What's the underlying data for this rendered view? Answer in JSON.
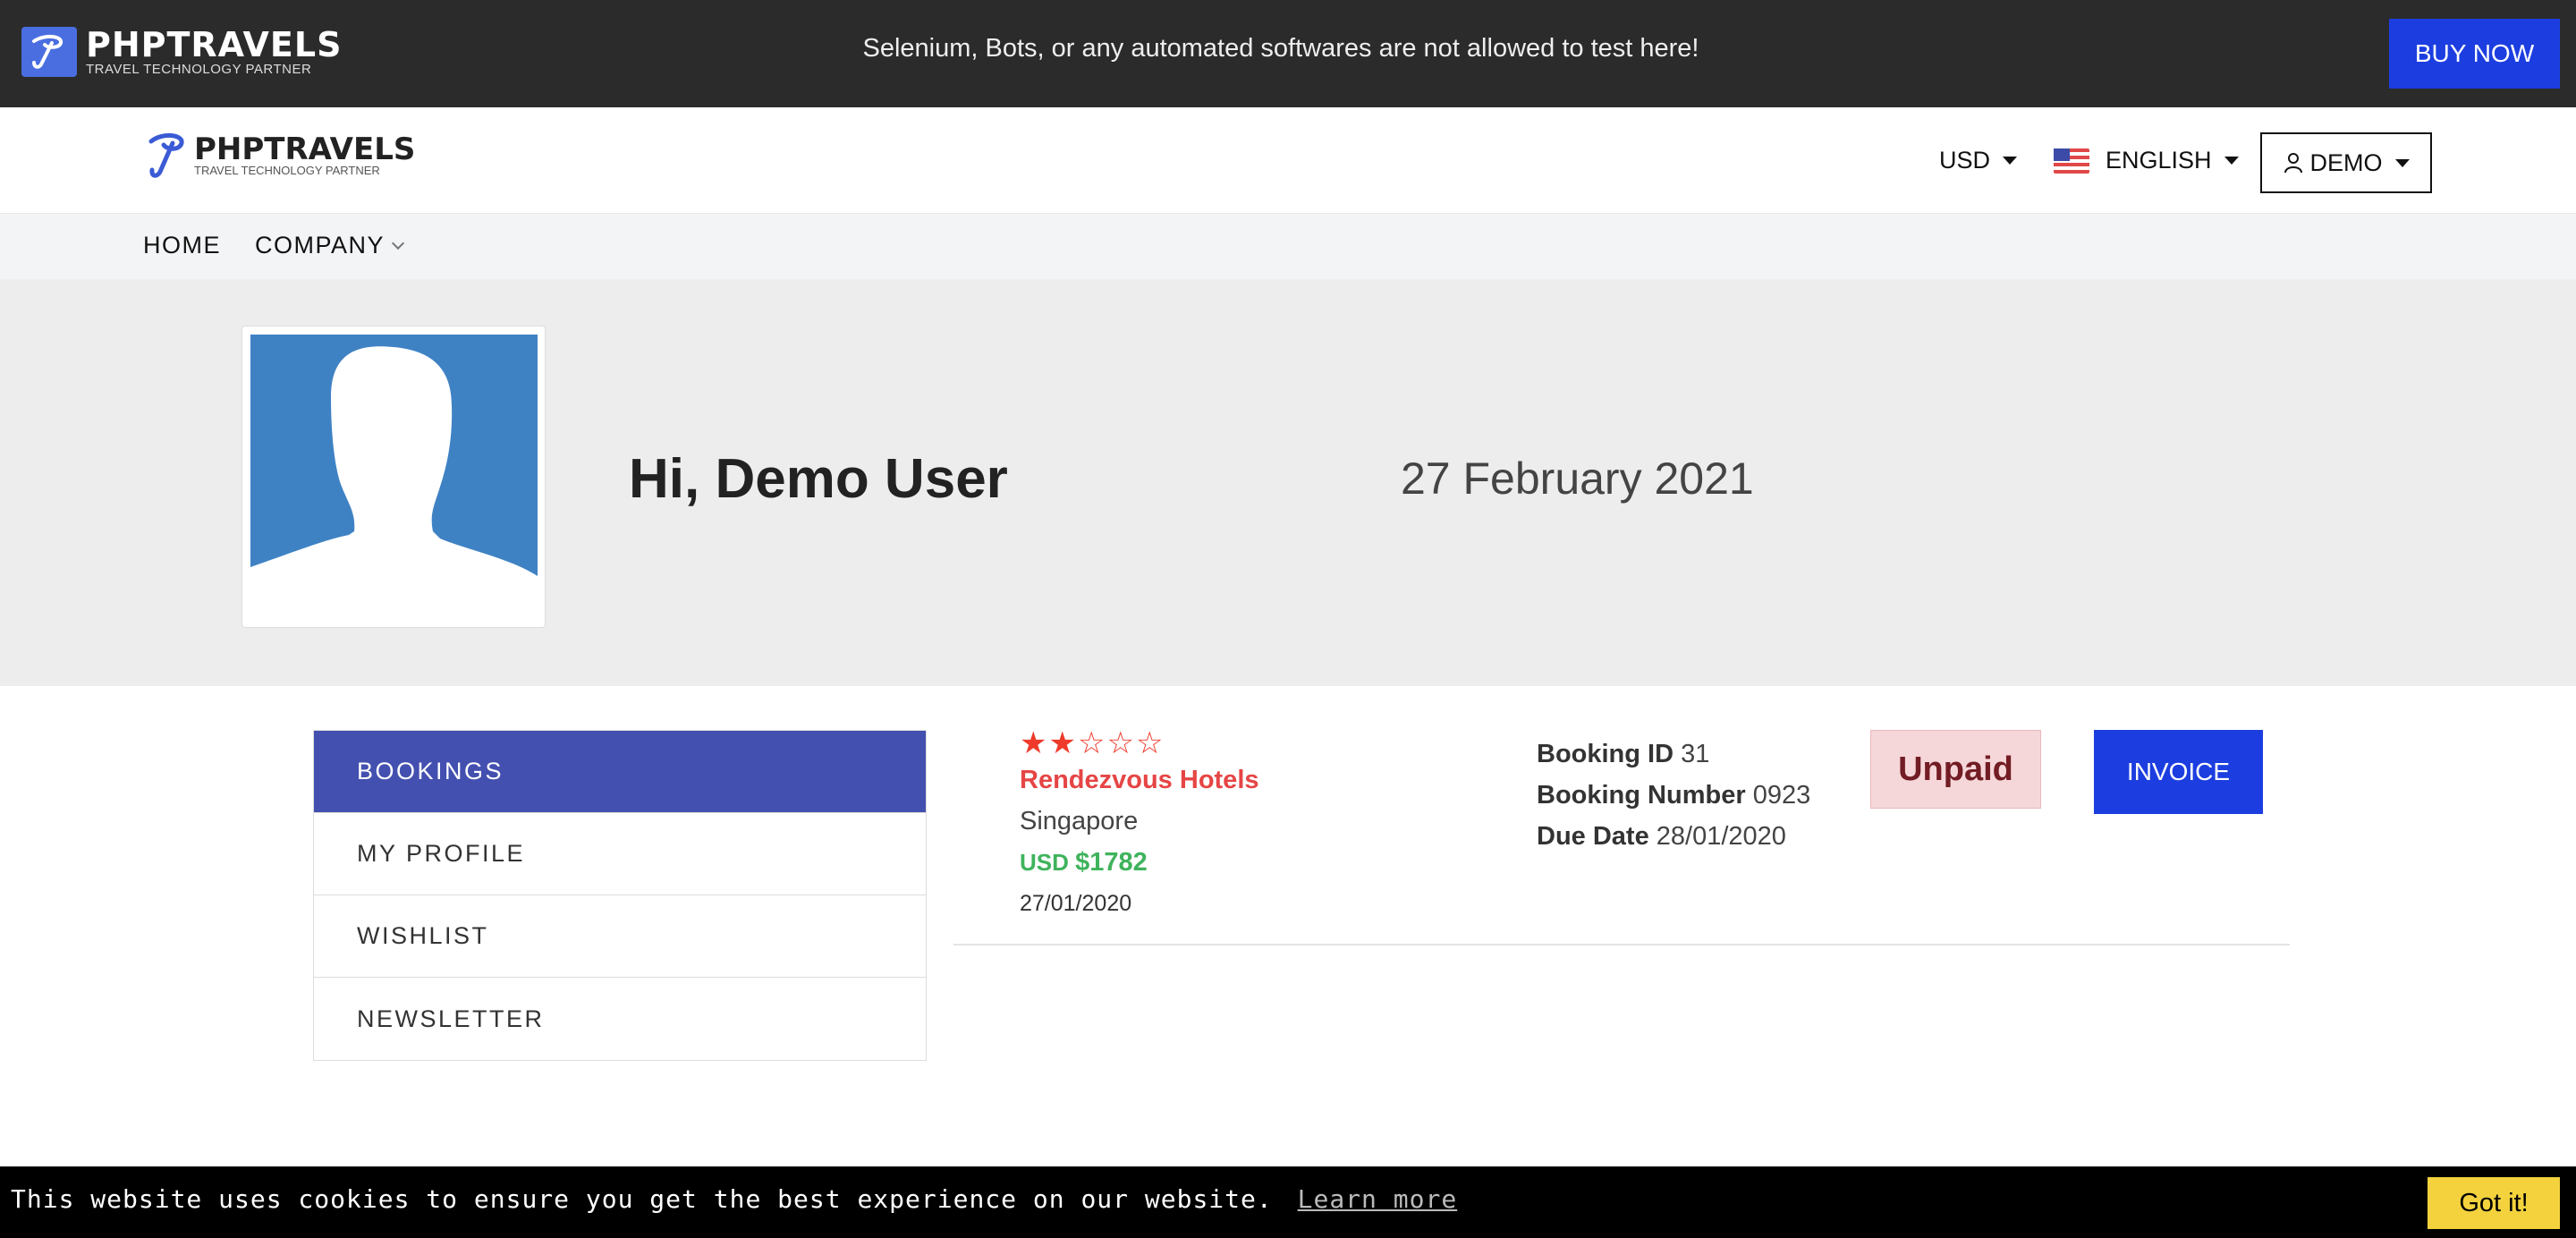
{
  "topbar": {
    "brand": "PHPTRAVELS",
    "tagline": "TRAVEL TECHNOLOGY PARTNER",
    "notice": "Selenium, Bots, or any automated softwares are not allowed to test here!",
    "buy_label": "BUY NOW"
  },
  "header": {
    "brand": "PHPTRAVELS",
    "tagline": "TRAVEL TECHNOLOGY PARTNER",
    "currency": "USD",
    "language": "ENGLISH",
    "account": "DEMO"
  },
  "nav": {
    "home": "HOME",
    "company": "COMPANY"
  },
  "profile": {
    "greeting": "Hi, Demo User",
    "date": "27 February 2021"
  },
  "sidebar": {
    "items": [
      {
        "label": "BOOKINGS"
      },
      {
        "label": "MY PROFILE"
      },
      {
        "label": "WISHLIST"
      },
      {
        "label": "NEWSLETTER"
      }
    ]
  },
  "booking": {
    "rating": 2,
    "rating_max": 5,
    "hotel": "Rendezvous Hotels",
    "city": "Singapore",
    "currency": "USD",
    "amount": "$1782",
    "date": "27/01/2020",
    "id_label": "Booking ID",
    "id": "31",
    "number_label": "Booking Number",
    "number": "0923",
    "due_label": "Due Date",
    "due": "28/01/2020",
    "status": "Unpaid",
    "invoice_label": "INVOICE"
  },
  "cookie": {
    "message": "This website uses cookies to ensure you get the best experience on our website.",
    "link": "Learn more",
    "button": "Got it!"
  },
  "colors": {
    "primary": "#1c3ee0",
    "sidebar_active": "#4350b0",
    "hotel_name": "#e64545",
    "price": "#3fb35c",
    "unpaid_bg": "#f5d7d9",
    "cookie_button": "#f3d23e"
  }
}
